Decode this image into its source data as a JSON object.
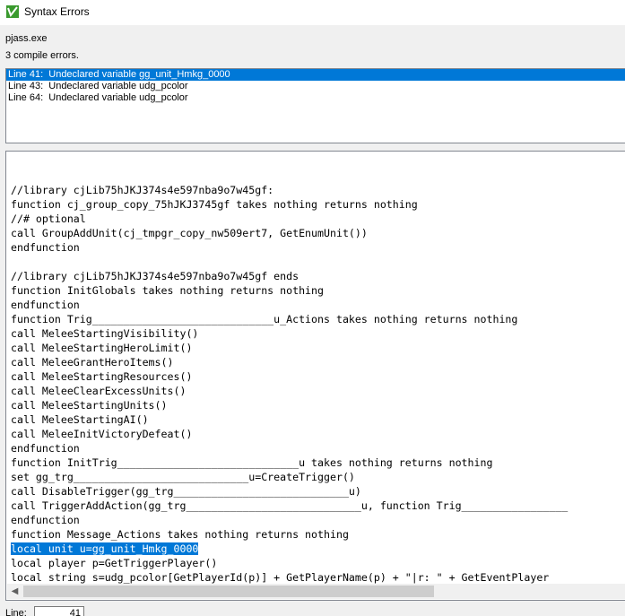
{
  "window": {
    "title": "Syntax Errors",
    "icon": "green-checkmark-app-icon"
  },
  "header": {
    "exe_label": "pjass.exe",
    "compile_errors": "3 compile errors."
  },
  "errors": [
    "Line 41:  Undeclared variable gg_unit_Hmkg_0000",
    "Line 43:  Undeclared variable udg_pcolor",
    "Line 64:  Undeclared variable udg_pcolor"
  ],
  "selected_error_index": 0,
  "code_lines": [
    "//library cjLib75hJKJ374s4e597nba9o7w45gf:",
    "function cj_group_copy_75hJKJ3745gf takes nothing returns nothing",
    "//# optional",
    "call GroupAddUnit(cj_tmpgr_copy_nw509ert7, GetEnumUnit())",
    "endfunction",
    "",
    "//library cjLib75hJKJ374s4e597nba9o7w45gf ends",
    "function InitGlobals takes nothing returns nothing",
    "endfunction",
    "function Trig_____________________________u_Actions takes nothing returns nothing",
    "call MeleeStartingVisibility()",
    "call MeleeStartingHeroLimit()",
    "call MeleeGrantHeroItems()",
    "call MeleeStartingResources()",
    "call MeleeClearExcessUnits()",
    "call MeleeStartingUnits()",
    "call MeleeStartingAI()",
    "call MeleeInitVictoryDefeat()",
    "endfunction",
    "function InitTrig_____________________________u takes nothing returns nothing",
    "set gg_trg____________________________u=CreateTrigger()",
    "call DisableTrigger(gg_trg____________________________u)",
    "call TriggerAddAction(gg_trg____________________________u, function Trig_________________",
    "endfunction",
    "function Message_Actions takes nothing returns nothing",
    "local unit u=gg_unit_Hmkg_0000",
    "local player p=GetTriggerPlayer()",
    "local string s=udg_pcolor[GetPlayerId(p)] + GetPlayerName(p) + \"|r: \" + GetEventPlayer"
  ],
  "highlighted_line_index": 25,
  "footer": {
    "line_label": "Line:",
    "line_value": "41"
  },
  "colors": {
    "selection": "#0078d7"
  }
}
